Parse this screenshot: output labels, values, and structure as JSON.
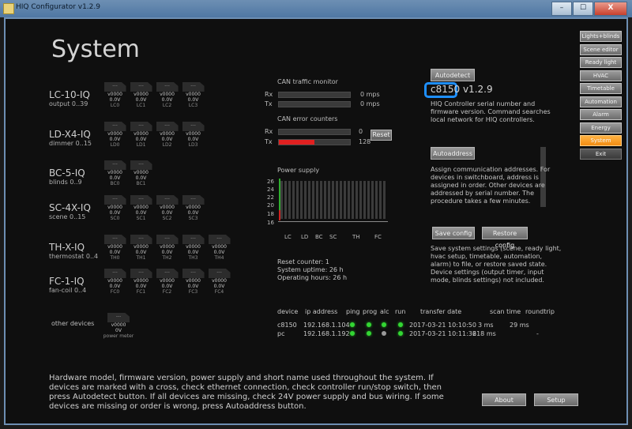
{
  "window": {
    "title": "HIQ Configurator v1.2.9",
    "buttons": [
      "–",
      "☐",
      "X"
    ]
  },
  "page_title": "System",
  "devices": [
    {
      "name": "LC-10-IQ",
      "sub": "output 0..39",
      "units": [
        {
          "tile": "---",
          "v1": "v0000",
          "v2": "0.0V",
          "label": "LC0"
        },
        {
          "tile": "---",
          "v1": "v0000",
          "v2": "0.0V",
          "label": "LC1"
        },
        {
          "tile": "---",
          "v1": "v0000",
          "v2": "0.0V",
          "label": "LC2"
        },
        {
          "tile": "---",
          "v1": "v0000",
          "v2": "0.0V",
          "label": "LC3"
        }
      ]
    },
    {
      "name": "LD-X4-IQ",
      "sub": "dimmer 0..15",
      "units": [
        {
          "tile": "---",
          "v1": "v0000",
          "v2": "0.0V",
          "label": "LD0"
        },
        {
          "tile": "---",
          "v1": "v0000",
          "v2": "0.0V",
          "label": "LD1"
        },
        {
          "tile": "---",
          "v1": "v0000",
          "v2": "0.0V",
          "label": "LD2"
        },
        {
          "tile": "---",
          "v1": "v0000",
          "v2": "0.0V",
          "label": "LD3"
        }
      ]
    },
    {
      "name": "BC-5-IQ",
      "sub": "blinds 0..9",
      "units": [
        {
          "tile": "---",
          "v1": "v0000",
          "v2": "0.0V",
          "label": "BC0"
        },
        {
          "tile": "---",
          "v1": "v0000",
          "v2": "0.0V",
          "label": "BC1"
        }
      ]
    },
    {
      "name": "SC-4X-IQ",
      "sub": "scene 0..15",
      "units": [
        {
          "tile": "---",
          "v1": "v0000",
          "v2": "0.0V",
          "label": "SC0"
        },
        {
          "tile": "---",
          "v1": "v0000",
          "v2": "0.0V",
          "label": "SC1"
        },
        {
          "tile": "---",
          "v1": "v0000",
          "v2": "0.0V",
          "label": "SC2"
        },
        {
          "tile": "---",
          "v1": "v0000",
          "v2": "0.0V",
          "label": "SC3"
        }
      ]
    },
    {
      "name": "TH-X-IQ",
      "sub": "thermostat 0..4",
      "units": [
        {
          "tile": "---",
          "v1": "v0000",
          "v2": "0.0V",
          "label": "TH0"
        },
        {
          "tile": "---",
          "v1": "v0000",
          "v2": "0.0V",
          "label": "TH1"
        },
        {
          "tile": "---",
          "v1": "v0000",
          "v2": "0.0V",
          "label": "TH2"
        },
        {
          "tile": "---",
          "v1": "v0000",
          "v2": "0.0V",
          "label": "TH3"
        },
        {
          "tile": "---",
          "v1": "v0000",
          "v2": "0.0V",
          "label": "TH4"
        }
      ]
    },
    {
      "name": "FC-1-IQ",
      "sub": "fan-coil 0..4",
      "units": [
        {
          "tile": "---",
          "v1": "v0000",
          "v2": "0.0V",
          "label": "FC0"
        },
        {
          "tile": "---",
          "v1": "v0000",
          "v2": "0.0V",
          "label": "FC1"
        },
        {
          "tile": "---",
          "v1": "v0000",
          "v2": "0.0V",
          "label": "FC2"
        },
        {
          "tile": "---",
          "v1": "v0000",
          "v2": "0.0V",
          "label": "FC3"
        },
        {
          "tile": "---",
          "v1": "v0000",
          "v2": "0.0V",
          "label": "FC4"
        }
      ]
    }
  ],
  "other_devices": {
    "label": "other devices",
    "unit": {
      "tile": "---",
      "v1": "v0000",
      "v2": "0V",
      "label": "power meter"
    }
  },
  "can_traffic": {
    "title": "CAN traffic monitor",
    "rx_label": "Rx",
    "tx_label": "Tx",
    "rx_value": "0 mps",
    "tx_value": "0 mps",
    "rx_fill": 0,
    "tx_fill": 0
  },
  "can_errors": {
    "title": "CAN error counters",
    "rx_label": "Rx",
    "tx_label": "Tx",
    "rx_value": "0",
    "tx_value": "128",
    "rx_fill": 0,
    "tx_fill": 0.5,
    "reset_label": "Reset"
  },
  "power_supply": {
    "title": "Power supply",
    "y_ticks": [
      "26",
      "24",
      "22",
      "20",
      "18",
      "16"
    ],
    "x_labels": [
      "LC",
      "LD",
      "BC",
      "SC",
      "TH",
      "FC"
    ]
  },
  "stats": {
    "reset_counter": "Reset counter: 1",
    "uptime": "System uptime: 26 h",
    "operating": "Operating hours: 26 h"
  },
  "controller": {
    "autodetect_label": "Autodetect",
    "serial": "c8150 v1.2.9",
    "desc": [
      "HIQ Controller serial number and",
      "firmware version. Command searches",
      "local network for HIQ controllers."
    ],
    "autoaddress_label": "Autoaddress",
    "autoaddress_desc": [
      "Assign communication addresses. For",
      "devices in switchboard, address is",
      "assigned in order. Other devices are",
      "addressed by serial number. The",
      "procedure takes a few minutes."
    ],
    "save_label": "Save config",
    "restore_label": "Restore config",
    "save_desc": [
      "Save system settings (scene, ready light,",
      "hvac setup, timetable, automation,",
      "alarm) to file, or restore saved state.",
      "Device settings (output timer, input",
      "mode, blinds settings) not included."
    ]
  },
  "table": {
    "headers": [
      "device",
      "ip address",
      "ping",
      "prog",
      "alc",
      "run",
      "transfer date",
      "scan time",
      "roundtrip"
    ],
    "rows": [
      {
        "device": "c8150",
        "ip": "192.168.1.104",
        "leds": [
          "green",
          "green",
          "green",
          "green"
        ],
        "date": "2017-03-21 10:10:50",
        "scan": "3 ms",
        "roundtrip": "29 ms"
      },
      {
        "device": "pc",
        "ip": "192.168.1.192",
        "leds": [
          "green",
          "green",
          "gray",
          "green"
        ],
        "date": "2017-03-21 10:11:36",
        "scan": "218 ms",
        "roundtrip": "-"
      }
    ]
  },
  "sidebar": {
    "items": [
      "Lights+blinds",
      "Scene editor",
      "Ready light",
      "HVAC",
      "Timetable",
      "Automation",
      "Alarm",
      "Energy",
      "System",
      "Exit"
    ],
    "active": "System"
  },
  "footer": {
    "help": "Hardware model, firmware version, power supply and short name used throughout the system. If devices are marked with a cross, check ethernet connection, check controller run/stop switch, then press Autodetect button. If all devices are missing, check 24V power supply and bus wiring. If some devices are missing or order is wrong, press Autoaddress button.",
    "about_label": "About",
    "setup_label": "Setup"
  },
  "colors": {
    "accent": "#f6931a",
    "highlight": "#1e8fff",
    "error": "#e02020",
    "ok": "#33d633"
  }
}
